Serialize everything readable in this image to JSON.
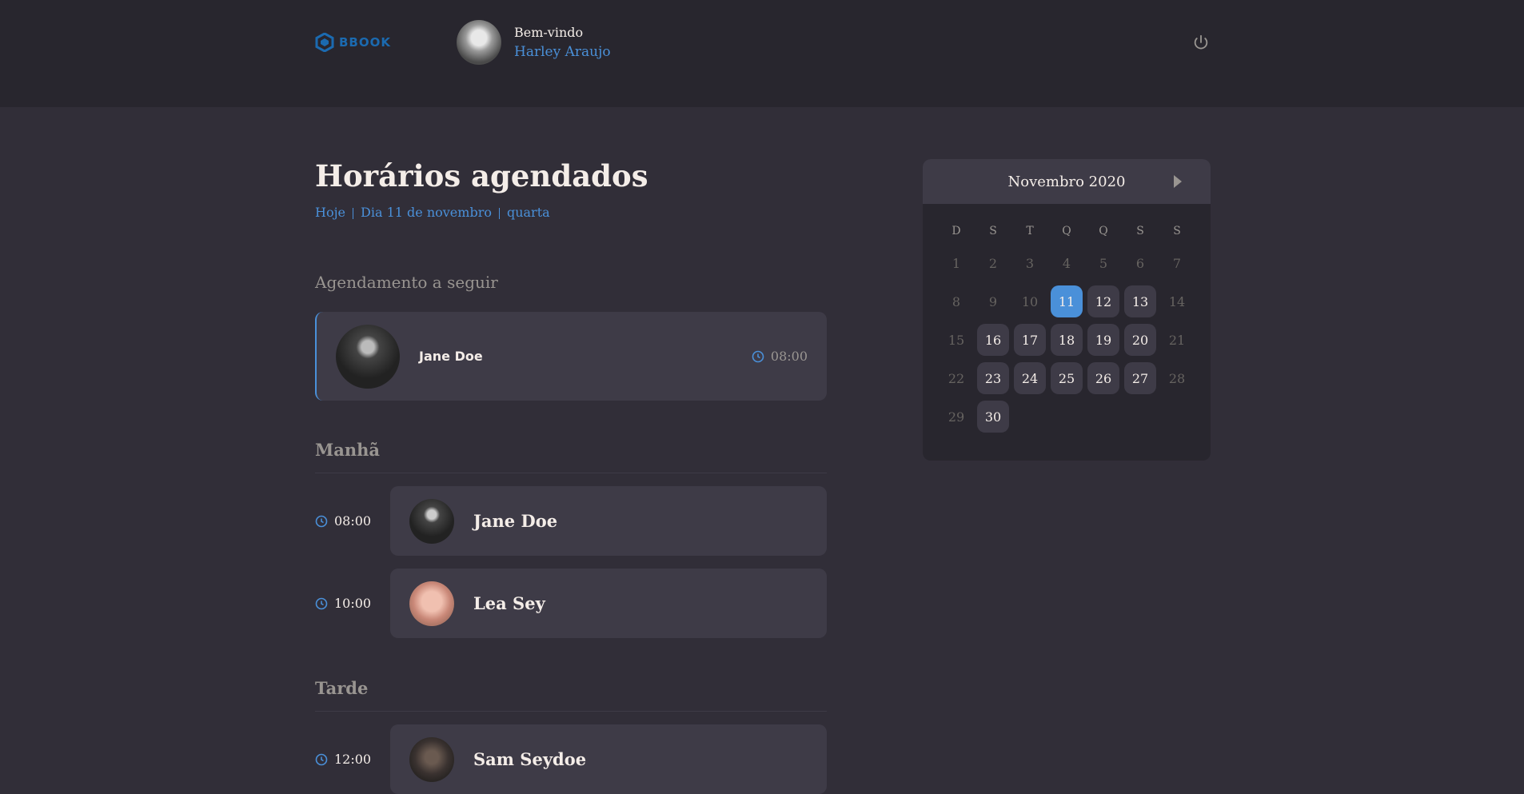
{
  "header": {
    "logo_text": "BBOOK",
    "welcome": "Bem-vindo",
    "user_name": "Harley Araujo"
  },
  "schedule": {
    "title": "Horários agendados",
    "today": "Hoje",
    "day": "Dia 11 de novembro",
    "weekday": "quarta",
    "next_label": "Agendamento a seguir",
    "next": {
      "name": "Jane Doe",
      "time": "08:00"
    },
    "morning": {
      "label": "Manhã",
      "items": [
        {
          "time": "08:00",
          "name": "Jane Doe"
        },
        {
          "time": "10:00",
          "name": "Lea Sey"
        }
      ]
    },
    "afternoon": {
      "label": "Tarde",
      "items": [
        {
          "time": "12:00",
          "name": "Sam Seydoe"
        }
      ]
    }
  },
  "calendar": {
    "month": "Novembro 2020",
    "weekdays": [
      "D",
      "S",
      "T",
      "Q",
      "Q",
      "S",
      "S"
    ],
    "days": [
      "1",
      "2",
      "3",
      "4",
      "5",
      "6",
      "7",
      "8",
      "9",
      "10",
      "11",
      "12",
      "13",
      "14",
      "15",
      "16",
      "17",
      "18",
      "19",
      "20",
      "21",
      "22",
      "23",
      "24",
      "25",
      "26",
      "27",
      "28",
      "29",
      "30"
    ],
    "selected": "11",
    "available": [
      "11",
      "12",
      "13",
      "16",
      "17",
      "18",
      "19",
      "20",
      "23",
      "24",
      "25",
      "26",
      "27",
      "30"
    ]
  },
  "colors": {
    "accent": "#4a90d9",
    "background": "#312e38",
    "card": "#3e3b47",
    "header": "#28262e"
  }
}
